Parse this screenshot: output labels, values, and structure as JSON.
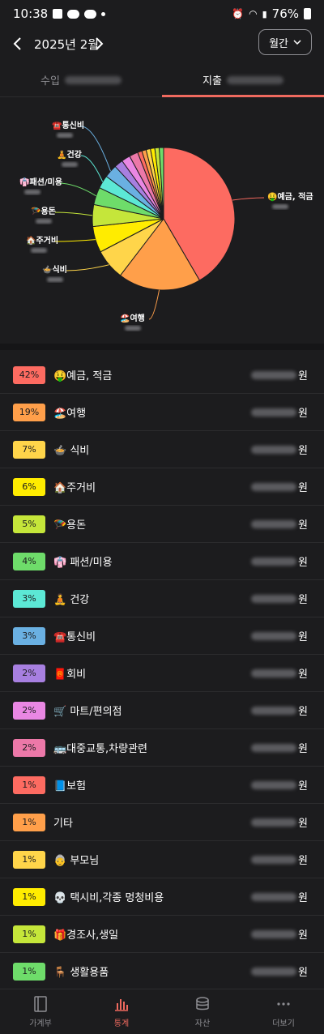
{
  "status": {
    "time": "10:38",
    "battery": "76%"
  },
  "header": {
    "month": "2025년 2월",
    "period": "월간"
  },
  "tabs": [
    {
      "label": "수입"
    },
    {
      "label": "지출"
    }
  ],
  "chart_data": {
    "type": "pie",
    "labels": [
      "🤑예금, 적금",
      "🏖️여행",
      "🍲식비",
      "🏠주거비",
      "🪂용돈",
      "👘패션/미용",
      "🧘건강",
      "☎️통신비",
      "🧧회비",
      "🛒마트/편의점",
      "🚌대중교통,차량관련",
      "📘보험",
      "기타",
      "👵부모님",
      "💀택시비,각종 멍청비용",
      "🎁경조사,생일",
      "🪑생활용품"
    ],
    "values": [
      42,
      19,
      7,
      6,
      5,
      4,
      3,
      3,
      2,
      2,
      2,
      1,
      1,
      1,
      1,
      1,
      1
    ],
    "colors": [
      "#fd6b61",
      "#ff9f4a",
      "#ffd54a",
      "#ffec00",
      "#c5e63a",
      "#6edc6a",
      "#5ce8d5",
      "#6ab0e2",
      "#a77fe0",
      "#e987e3",
      "#ec78a8",
      "#fd6b61",
      "#ff9f4a",
      "#ffd54a",
      "#ffec00",
      "#c5e63a",
      "#6edc6a"
    ],
    "callouts": [
      "🤑예금, 적금",
      "🏖️여행",
      "🍲식비",
      "🏠주거비",
      "🪂용돈",
      "👘패션/미용",
      "🧘건강",
      "☎️통신비"
    ]
  },
  "list": [
    {
      "pct": "42%",
      "name": "🤑예금, 적금",
      "color": "#fd6b61"
    },
    {
      "pct": "19%",
      "name": "🏖️여행",
      "color": "#ff9f4a"
    },
    {
      "pct": "7%",
      "name": "🍲 식비",
      "color": "#ffd54a"
    },
    {
      "pct": "6%",
      "name": "🏠주거비",
      "color": "#ffec00"
    },
    {
      "pct": "5%",
      "name": "🪂용돈",
      "color": "#c5e63a"
    },
    {
      "pct": "4%",
      "name": "👘 패션/미용",
      "color": "#6edc6a"
    },
    {
      "pct": "3%",
      "name": "🧘 건강",
      "color": "#5ce8d5"
    },
    {
      "pct": "3%",
      "name": "☎️통신비",
      "color": "#6ab0e2"
    },
    {
      "pct": "2%",
      "name": "🧧회비",
      "color": "#a77fe0"
    },
    {
      "pct": "2%",
      "name": "🛒 마트/편의점",
      "color": "#e987e3"
    },
    {
      "pct": "2%",
      "name": "🚌대중교통,차량관련",
      "color": "#ec78a8"
    },
    {
      "pct": "1%",
      "name": "📘보험",
      "color": "#fd6b61"
    },
    {
      "pct": "1%",
      "name": "기타",
      "color": "#ff9f4a"
    },
    {
      "pct": "1%",
      "name": "👵 부모님",
      "color": "#ffd54a"
    },
    {
      "pct": "1%",
      "name": "💀 택시비,각종 멍청비용",
      "color": "#ffec00"
    },
    {
      "pct": "1%",
      "name": "🎁경조사,생일",
      "color": "#c5e63a"
    },
    {
      "pct": "1%",
      "name": "🪑 생활용품",
      "color": "#6edc6a"
    }
  ],
  "currency_unit": "원",
  "bottom_nav": [
    {
      "label": "가계부",
      "icon": "book-icon"
    },
    {
      "label": "통계",
      "icon": "bar-chart-icon"
    },
    {
      "label": "자산",
      "icon": "coins-icon"
    },
    {
      "label": "더보기",
      "icon": "more-icon"
    }
  ]
}
